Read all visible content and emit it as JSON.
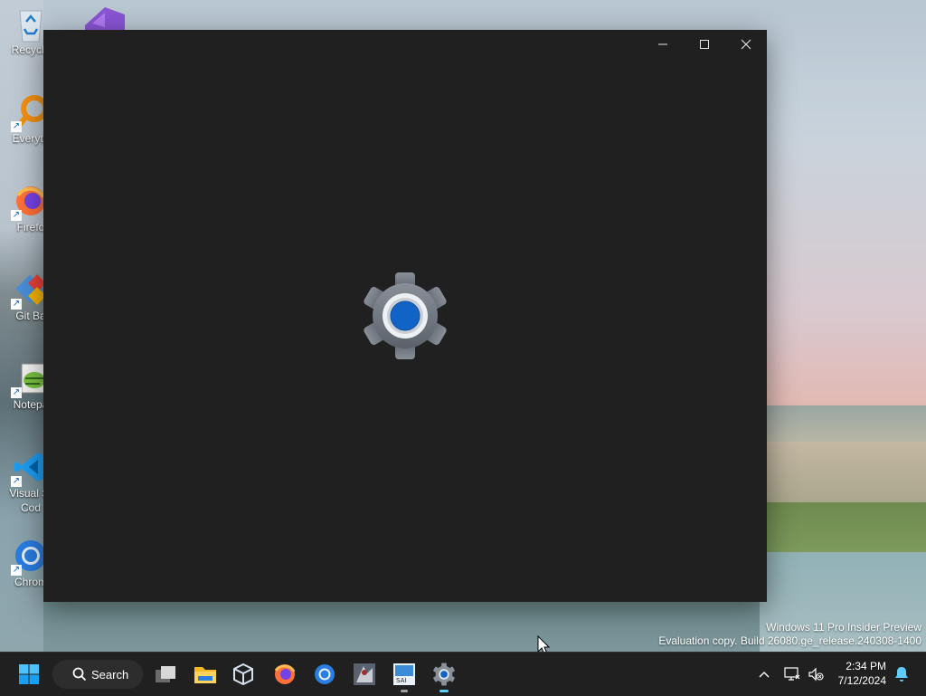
{
  "desktop": {
    "icons": [
      {
        "label": "Recycle",
        "icon": "recycle-bin-icon"
      },
      {
        "label": "",
        "icon": "visual-studio-icon"
      },
      {
        "label": "Everyth",
        "icon": "everything-search-icon"
      },
      {
        "label": "Firefo",
        "icon": "firefox-icon"
      },
      {
        "label": "Git Ba",
        "icon": "git-bash-icon"
      },
      {
        "label": "Notepa",
        "icon": "notepad-plus-plus-icon"
      },
      {
        "label": "Visual St",
        "label2": "Cod",
        "icon": "vscode-icon"
      },
      {
        "label": "Chrom",
        "icon": "chrome-icon"
      }
    ]
  },
  "window": {
    "app": "Settings",
    "splash_icon": "settings-gear-icon",
    "controls": {
      "minimize": "minimize-icon",
      "maximize": "maximize-icon",
      "close": "close-icon"
    }
  },
  "watermark": {
    "line1": "Windows 11 Pro Insider Preview",
    "line2": "Evaluation copy. Build 26080.ge_release.240308-1400"
  },
  "taskbar": {
    "search_label": "Search",
    "apps": [
      {
        "name": "Task view",
        "icon": "task-view-icon"
      },
      {
        "name": "File Explorer",
        "icon": "folder-icon"
      },
      {
        "name": "VirtualBox",
        "icon": "virtualbox-icon"
      },
      {
        "name": "Firefox",
        "icon": "firefox-icon"
      },
      {
        "name": "Chrome",
        "icon": "chrome-icon"
      },
      {
        "name": "Game",
        "icon": "game-app-icon"
      },
      {
        "name": "Snipping",
        "icon": "snip-app-icon"
      },
      {
        "name": "Settings",
        "icon": "settings-gear-icon"
      }
    ],
    "tray": {
      "time": "2:34 PM",
      "date": "7/12/2024"
    }
  },
  "colors": {
    "accent": "#0f6cbd",
    "taskbar": "#202020",
    "window": "#202020"
  }
}
